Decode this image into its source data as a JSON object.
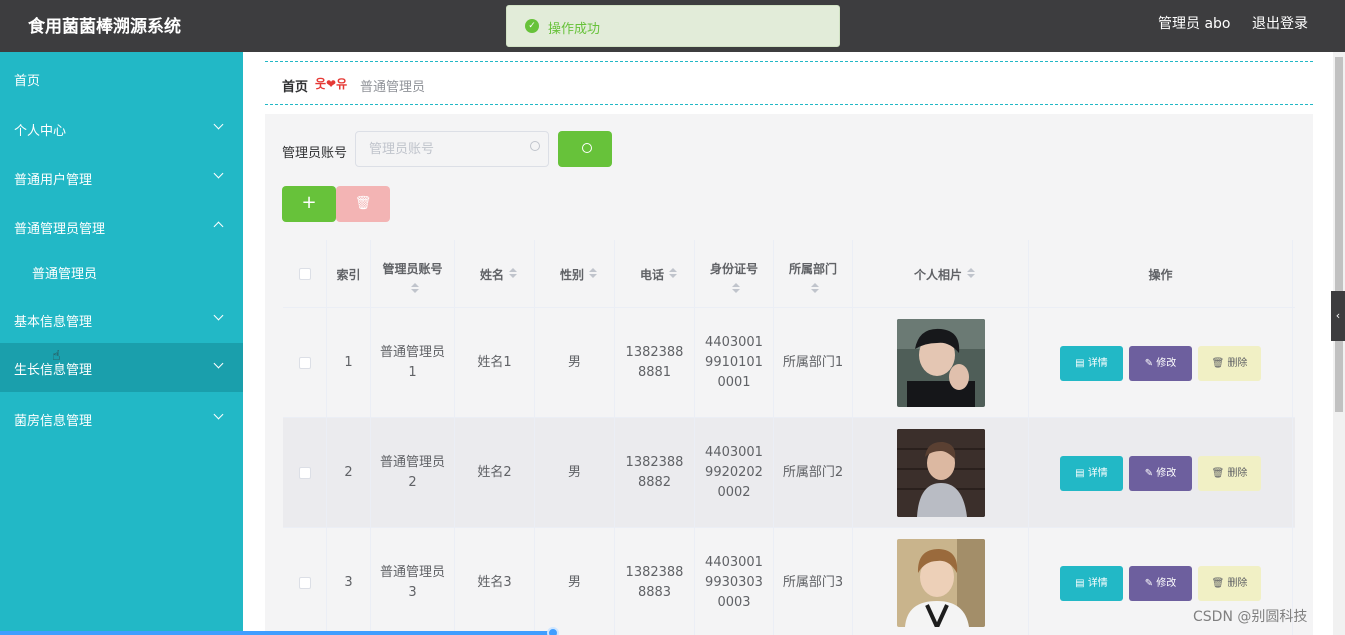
{
  "header": {
    "app_title": "食用菌菌棒溯源系统",
    "user_label": "管理员 abo",
    "logout_label": "退出登录"
  },
  "toast": {
    "message": "操作成功",
    "icon": "check-circle-icon",
    "color": "#67c23a"
  },
  "sidebar": {
    "items": [
      {
        "label": "首页"
      },
      {
        "label": "个人中心"
      },
      {
        "label": "普通用户管理"
      },
      {
        "label": "普通管理员管理"
      },
      {
        "label": "普通管理员"
      },
      {
        "label": "基本信息管理"
      },
      {
        "label": "生长信息管理"
      },
      {
        "label": "菌房信息管理"
      }
    ],
    "bg_color": "#22b8c6",
    "active_color": "#1a9fac"
  },
  "breadcrumb": {
    "home": "首页",
    "separator": "웃❤유",
    "current": "普通管理员"
  },
  "search": {
    "label": "管理员账号",
    "placeholder": "管理员账号"
  },
  "buttons": {
    "add": "+",
    "delete_icon": "trash-icon",
    "search_icon": "search-icon"
  },
  "table": {
    "columns": [
      "索引",
      "管理员账号",
      "姓名",
      "性别",
      "电话",
      "身份证号",
      "所属部门",
      "个人相片",
      "操作"
    ],
    "rows": [
      {
        "index": "1",
        "account": "普通管理员1",
        "name": "姓名1",
        "gender": "男",
        "phone": "13823888881",
        "id_number": "440300199101010001",
        "department": "所属部门1"
      },
      {
        "index": "2",
        "account": "普通管理员2",
        "name": "姓名2",
        "gender": "男",
        "phone": "13823888882",
        "id_number": "440300199202020002",
        "department": "所属部门2"
      },
      {
        "index": "3",
        "account": "普通管理员3",
        "name": "姓名3",
        "gender": "男",
        "phone": "13823888883",
        "id_number": "440300199303030003",
        "department": "所属部门3"
      }
    ],
    "actions": {
      "detail": "详情",
      "edit": "修改",
      "delete": "删除"
    }
  },
  "watermark": "CSDN @别圆科技",
  "colors": {
    "primary": "#22b8c6",
    "success": "#67c23a",
    "edit": "#6d5f9e",
    "delete_light": "#f1f0c5",
    "topbar": "#3d3d3f"
  }
}
